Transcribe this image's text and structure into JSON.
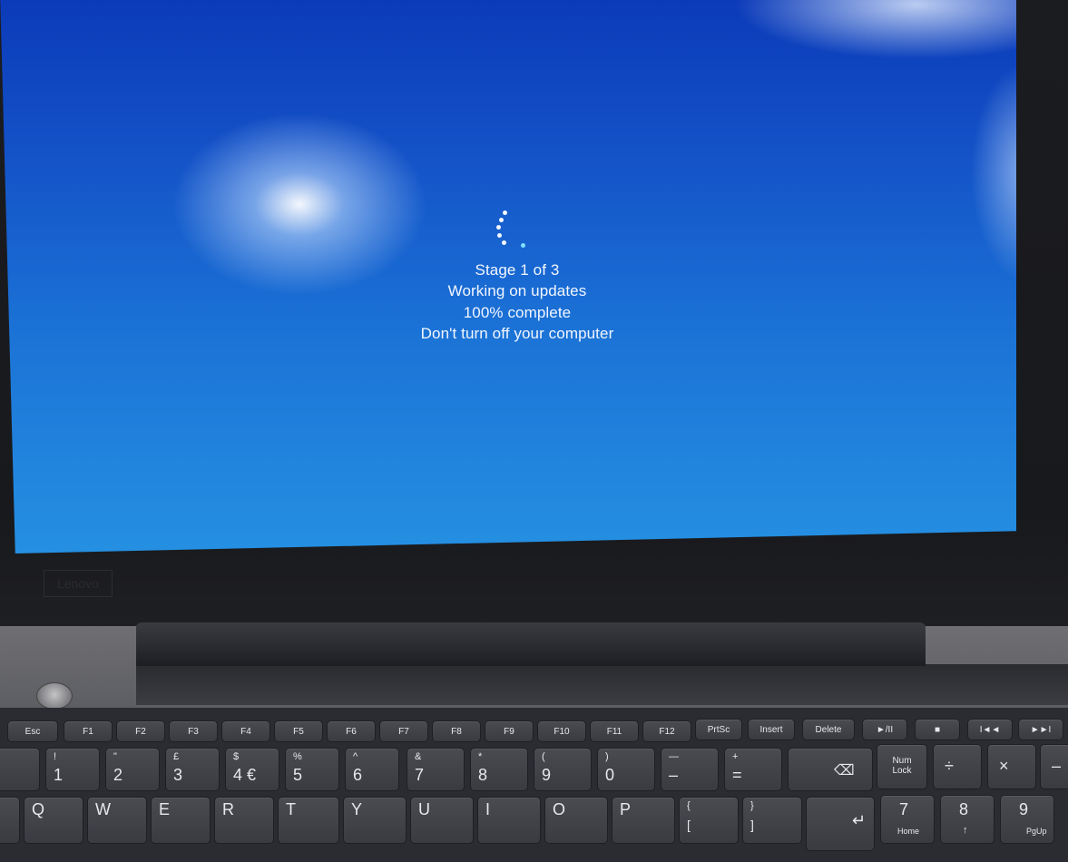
{
  "screen": {
    "stage_text": "Stage 1 of 3",
    "status_text": "Working on updates",
    "progress_text": "100% complete",
    "warning_text": "Don't turn off your computer",
    "progress_percent": 100,
    "background_color": "#1b72d6"
  },
  "bezel": {
    "brand_label": "Lenovo"
  },
  "keyboard": {
    "function_row": [
      "Esc",
      "F1",
      "F2",
      "F3",
      "F4",
      "F5",
      "F6",
      "F7",
      "F8",
      "F9",
      "F10",
      "F11",
      "F12",
      "PrtSc",
      "Insert",
      "Delete",
      "►/II",
      "■",
      "I◄◄",
      "►►I"
    ],
    "number_row": [
      {
        "main": "1",
        "top": "!"
      },
      {
        "main": "2",
        "top": "\""
      },
      {
        "main": "3",
        "top": "£"
      },
      {
        "main": "4 €",
        "top": "$"
      },
      {
        "main": "5",
        "top": "%"
      },
      {
        "main": "6",
        "top": "^"
      },
      {
        "main": "7",
        "top": "&"
      },
      {
        "main": "8",
        "top": "*"
      },
      {
        "main": "9",
        "top": "("
      },
      {
        "main": "0",
        "top": ")"
      },
      {
        "main": "–",
        "top": "—"
      },
      {
        "main": "=",
        "top": "+"
      }
    ],
    "letter_row": [
      "Q",
      "W",
      "E",
      "R",
      "T",
      "Y",
      "U",
      "I",
      "O",
      "P"
    ],
    "bracket_keys": [
      {
        "main": "[",
        "top": "{"
      },
      {
        "main": "]",
        "top": "}"
      }
    ],
    "numpad_row1": [
      "Num Lock",
      "÷",
      "×",
      "–"
    ],
    "numpad_row2": [
      {
        "main": "7",
        "sub": "Home"
      },
      {
        "main": "8",
        "sub": "↑"
      },
      {
        "main": "9",
        "sub": "PgUp"
      }
    ]
  }
}
